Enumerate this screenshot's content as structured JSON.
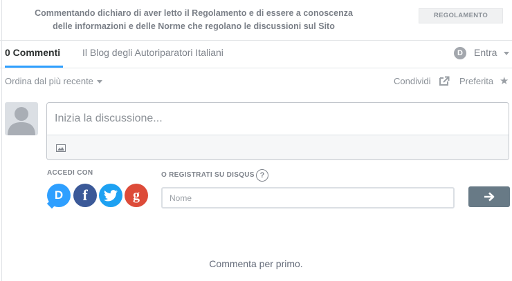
{
  "notice": {
    "line1": "Commentando dichiaro di aver letto il Regolamento e di essere a conoscenza",
    "line2": "delle informazioni e delle Norme che regolano le discussioni sul Sito",
    "button": "REGOLAMENTO"
  },
  "nav": {
    "comments_tab": "0 Commenti",
    "community_tab": "Il Blog degli Autoriparatori Italiani",
    "login_badge": "D",
    "login_label": "Entra"
  },
  "toolbar": {
    "sort": "Ordina dal più recente",
    "share": "Condividi",
    "favorite": "Preferita"
  },
  "composer": {
    "placeholder": "Inizia la discussione..."
  },
  "login": {
    "login_with": "ACCEDI CON",
    "providers": [
      {
        "name": "disqus",
        "glyph": "D",
        "color": "#2e9fff"
      },
      {
        "name": "facebook",
        "glyph": "f",
        "color": "#3b5998"
      },
      {
        "name": "twitter",
        "glyph": "twitter-bird-icon",
        "color": "#1da1f2"
      },
      {
        "name": "google",
        "glyph": "g",
        "color": "#dd4b39"
      }
    ],
    "register_label": "O REGISTRATI SU DISQUS",
    "help_glyph": "?",
    "name_placeholder": "Nome"
  },
  "empty_message": "Commenta per primo.",
  "colors": {
    "accent": "#2e9fff",
    "submit_button": "#687a86",
    "text_muted": "#7f848c"
  }
}
